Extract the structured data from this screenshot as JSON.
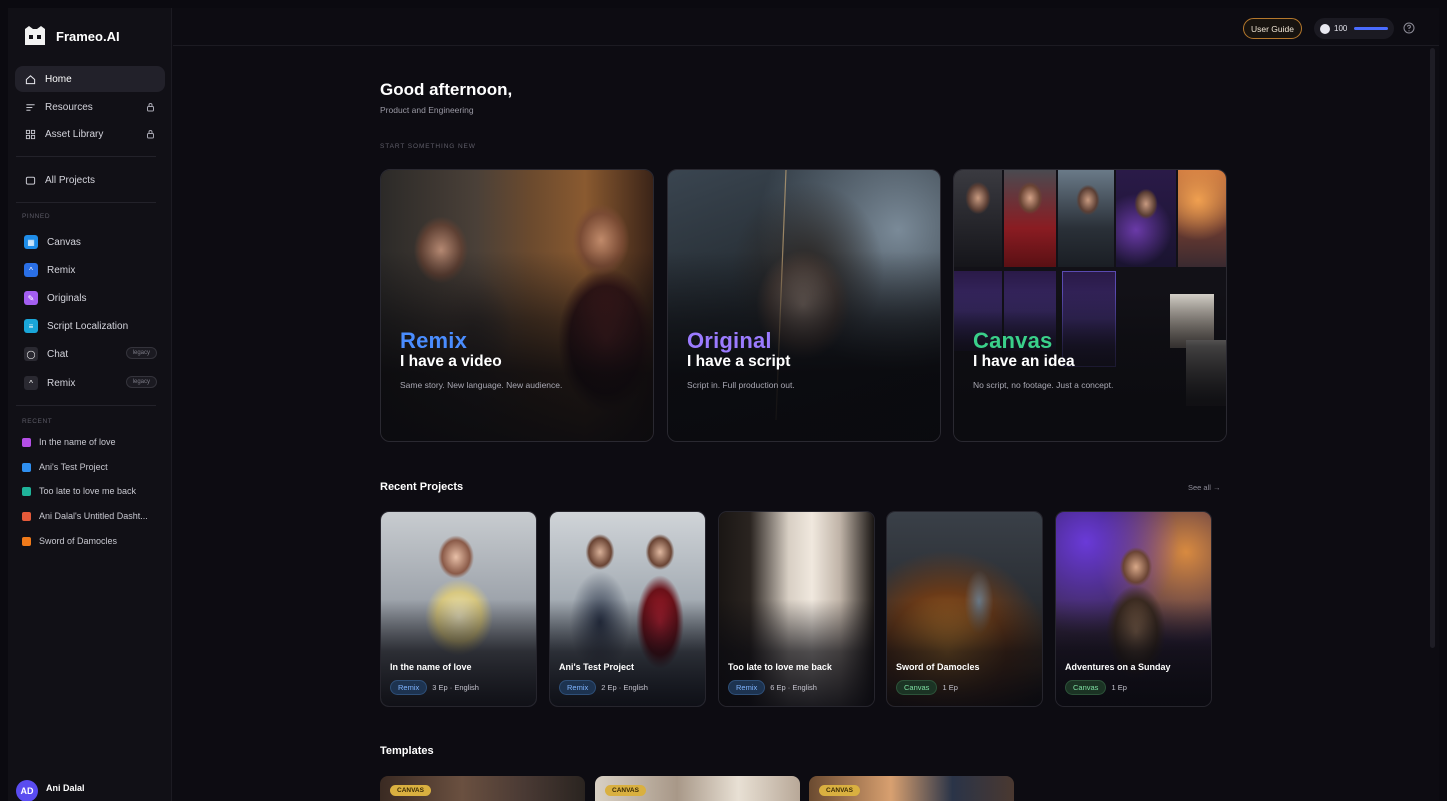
{
  "brand": {
    "name": "Frameo.AI"
  },
  "nav": {
    "home": "Home",
    "resources": "Resources",
    "asset_library": "Asset Library",
    "all_projects": "All Projects"
  },
  "pinned": {
    "label": "PINNED",
    "items": [
      {
        "label": "Canvas",
        "color": "#1f8de8"
      },
      {
        "label": "Remix",
        "color": "#2a6fe6"
      },
      {
        "label": "Originals",
        "color": "#a35ef0"
      },
      {
        "label": "Script Localization",
        "color": "#1aa6d9"
      },
      {
        "label": "Chat",
        "color": "#2a2931",
        "badge": "legacy"
      },
      {
        "label": "Remix",
        "color": "#2a2931",
        "badge": "legacy"
      }
    ]
  },
  "recent": {
    "label": "RECENT",
    "items": [
      {
        "label": "In the name of love",
        "color": "#b44fe6"
      },
      {
        "label": "Ani's Test Project",
        "color": "#2f8ff0"
      },
      {
        "label": "Too late to love me back",
        "color": "#1fb39a"
      },
      {
        "label": "Ani Dalal's Untitled Dasht...",
        "color": "#e45a3a"
      },
      {
        "label": "Sword of Damocles",
        "color": "#f07a1a"
      }
    ]
  },
  "user": {
    "initials": "AD",
    "name": "Ani Dalal"
  },
  "topbar": {
    "user_guide": "User Guide",
    "credits": "100"
  },
  "main": {
    "greeting": "Good afternoon,",
    "org": "Product and Engineering",
    "start_label": "START SOMETHING NEW",
    "cards": [
      {
        "title": "Remix",
        "subtitle": "I have a video",
        "desc": "Same story. New language. New audience.",
        "color": "#4a8dff"
      },
      {
        "title": "Original",
        "subtitle": "I have a script",
        "desc": "Script in. Full production out.",
        "color": "#9b7bff"
      },
      {
        "title": "Canvas",
        "subtitle": "I have an idea",
        "desc": "No script, no footage. Just a concept.",
        "color": "#3ad08a"
      }
    ],
    "recent_title": "Recent Projects",
    "see_all": "See all →",
    "projects": [
      {
        "name": "In the name of love",
        "tag": "Remix",
        "meta": "3 Ep · English"
      },
      {
        "name": "Ani's Test Project",
        "tag": "Remix",
        "meta": "2 Ep · English"
      },
      {
        "name": "Too late to love me back",
        "tag": "Remix",
        "meta": "6 Ep · English"
      },
      {
        "name": "Sword of Damocles",
        "tag": "Canvas",
        "meta": "1 Ep"
      },
      {
        "name": "Adventures on a Sunday",
        "tag": "Canvas",
        "meta": "1 Ep"
      }
    ],
    "templates_title": "Templates",
    "templates": [
      {
        "tag": "CANVAS"
      },
      {
        "tag": "CANVAS"
      },
      {
        "tag": "CANVAS"
      }
    ]
  },
  "icons": {
    "home": "home-icon",
    "resources": "list-icon",
    "asset_library": "grid-icon",
    "all_projects": "folder-icon",
    "lock": "lock-icon",
    "help": "help-circle-icon"
  }
}
